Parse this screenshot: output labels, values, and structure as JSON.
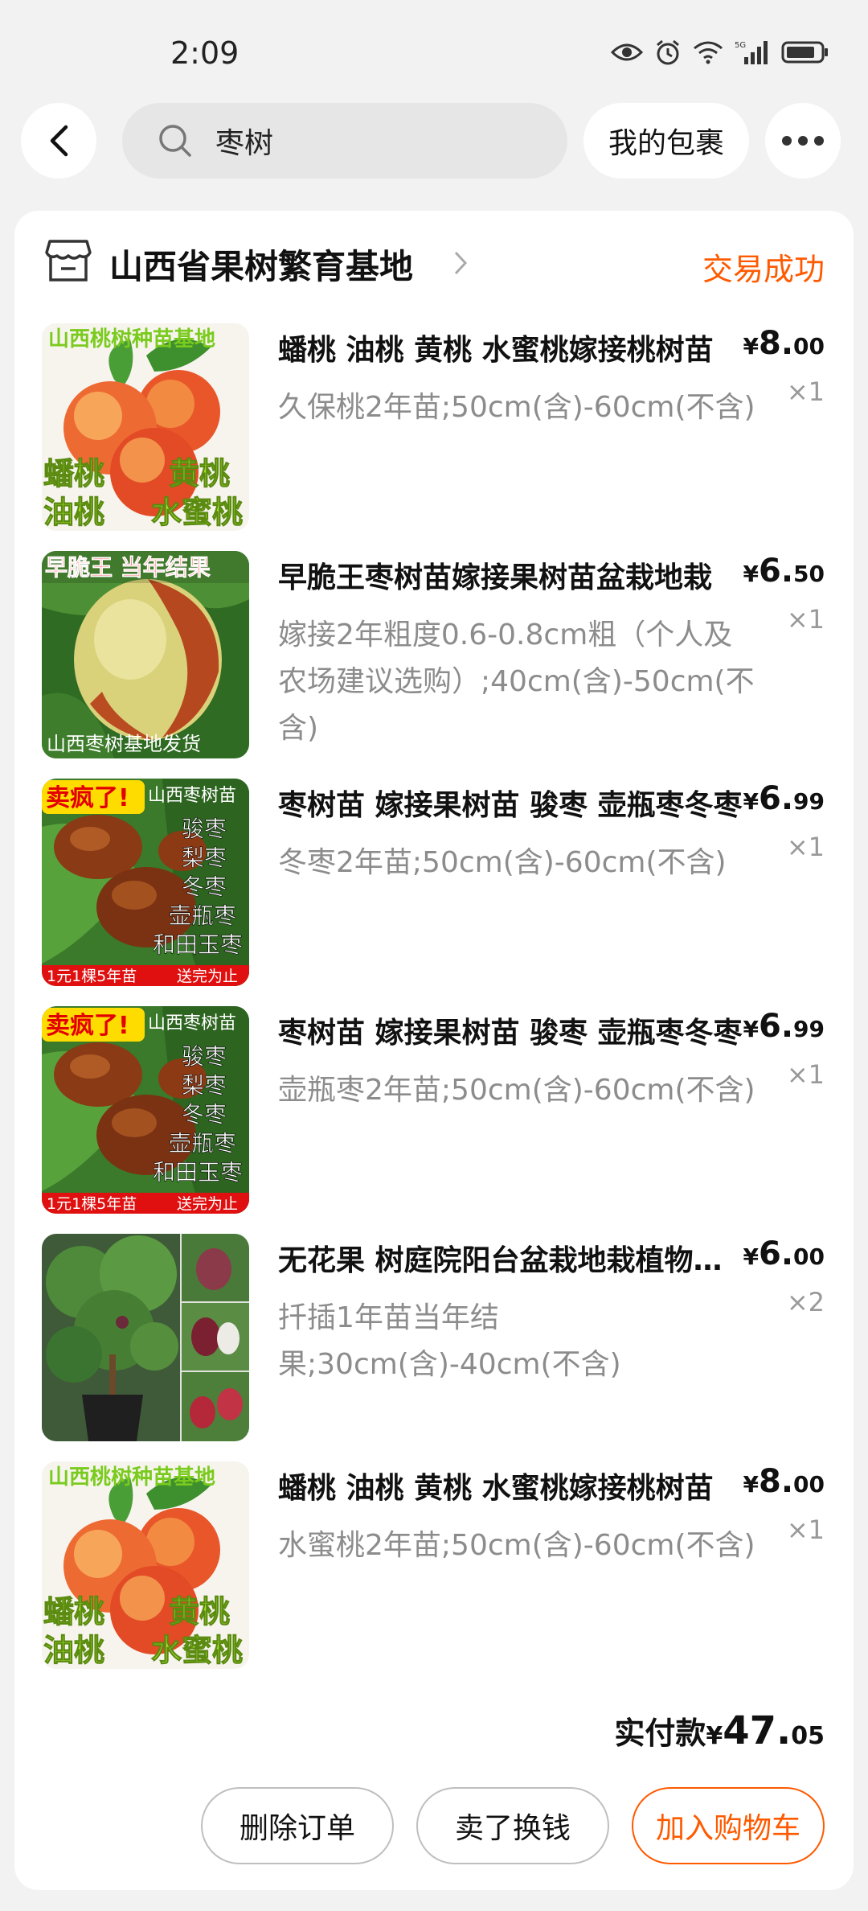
{
  "status_bar": {
    "time": "2:09",
    "network": "5G"
  },
  "top_bar": {
    "search_text": "枣树",
    "package_button": "我的包裹"
  },
  "shop": {
    "name": "山西省果树繁育基地",
    "status": "交易成功"
  },
  "items": [
    {
      "title": "蟠桃 油桃 黄桃 水蜜桃嫁接桃树苗",
      "spec": "久保桃2年苗;50cm(含)-60cm(不含)",
      "price_currency": "¥",
      "price_int": "8.",
      "price_dec": "00",
      "qty": "×1",
      "image": {
        "type": "peach",
        "top_text": "山西桃树种苗基地",
        "labels": [
          "蟠桃",
          "黄桃",
          "油桃",
          "水蜜桃"
        ]
      }
    },
    {
      "title": "早脆王枣树苗嫁接果树苗盆栽地栽",
      "spec": "嫁接2年粗度0.6-0.8cm粗（个人及农场建议选购）;40cm(含)-50cm(不含)",
      "price_currency": "¥",
      "price_int": "6.",
      "price_dec": "50",
      "qty": "×1",
      "image": {
        "type": "jujube-single",
        "top_text": "早脆王 当年结果",
        "bottom_text": "山西枣树基地发货"
      }
    },
    {
      "title": "枣树苗 嫁接果树苗 骏枣 壶瓶枣冬枣",
      "spec": "冬枣2年苗;50cm(含)-60cm(不含)",
      "price_currency": "¥",
      "price_int": "6.",
      "price_dec": "99",
      "qty": "×1",
      "image": {
        "type": "jujube-multi",
        "badge": "卖疯了!",
        "corner": "山西枣树苗",
        "list": [
          "骏枣",
          "梨枣",
          "冬枣",
          "壶瓶枣",
          "和田玉枣"
        ],
        "footer_left": "1元1棵5年苗",
        "footer_right": "送完为止"
      }
    },
    {
      "title": "枣树苗 嫁接果树苗 骏枣 壶瓶枣冬枣",
      "spec": "壶瓶枣2年苗;50cm(含)-60cm(不含)",
      "price_currency": "¥",
      "price_int": "6.",
      "price_dec": "99",
      "qty": "×1",
      "image": {
        "type": "jujube-multi",
        "badge": "卖疯了!",
        "corner": "山西枣树苗",
        "list": [
          "骏枣",
          "梨枣",
          "冬枣",
          "壶瓶枣",
          "和田玉枣"
        ],
        "footer_left": "1元1棵5年苗",
        "footer_right": "送完为止"
      }
    },
    {
      "title": "无花果 树庭院阳台盆栽地栽植物果苗",
      "spec": "扦插1年苗当年结果;30cm(含)-40cm(不含)",
      "price_currency": "¥",
      "price_int": "6.",
      "price_dec": "00",
      "qty": "×2",
      "image": {
        "type": "fig"
      }
    },
    {
      "title": "蟠桃 油桃 黄桃 水蜜桃嫁接桃树苗",
      "spec": "水蜜桃2年苗;50cm(含)-60cm(不含)",
      "price_currency": "¥",
      "price_int": "8.",
      "price_dec": "00",
      "qty": "×1",
      "image": {
        "type": "peach",
        "top_text": "山西桃树种苗基地",
        "labels": [
          "蟠桃",
          "黄桃",
          "油桃",
          "水蜜桃"
        ]
      }
    }
  ],
  "total": {
    "label": "实付款",
    "currency": "¥",
    "int": "47.",
    "dec": "05"
  },
  "actions": {
    "delete": "删除订单",
    "resell": "卖了换钱",
    "add_cart": "加入购物车"
  },
  "colors": {
    "accent": "#ff5a00",
    "page_bg": "#f2f2f2"
  }
}
